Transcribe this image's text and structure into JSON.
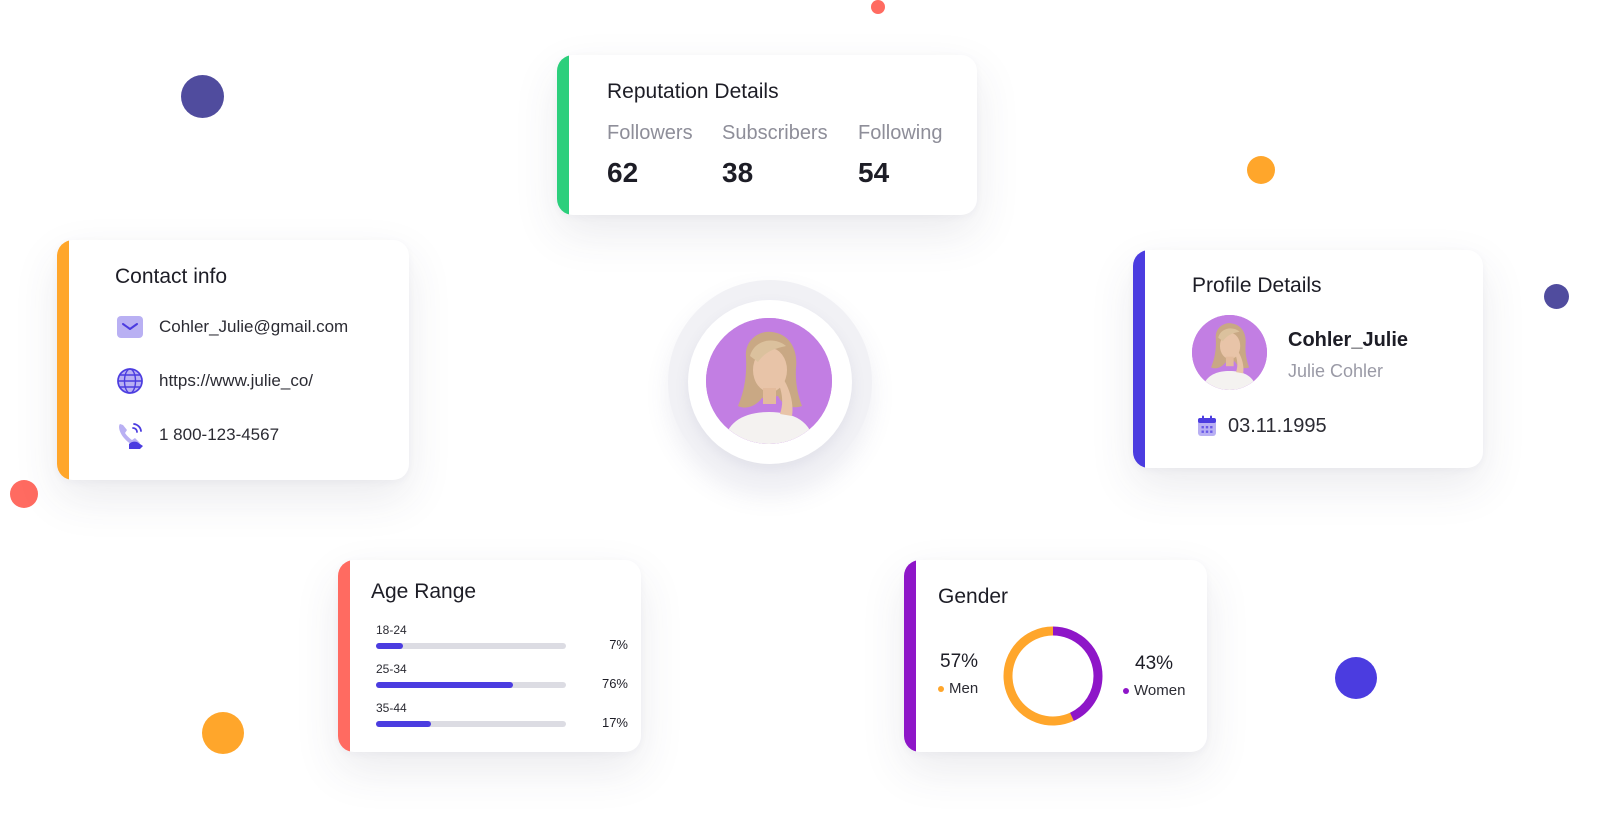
{
  "colors": {
    "green": "#2ccf7c",
    "orange": "#ffa62b",
    "indigo": "#4b3ce0",
    "coral": "#ff6b61",
    "purple": "#8e16c8",
    "navy": "#504c9e",
    "avatar_bg": "#c27ee3",
    "progress": "#4b3ce0"
  },
  "reputation": {
    "title": "Reputation Details",
    "stats": [
      {
        "label": "Followers",
        "value": "62"
      },
      {
        "label": "Subscribers",
        "value": "38"
      },
      {
        "label": "Following",
        "value": "54"
      }
    ]
  },
  "contact": {
    "title": "Contact info",
    "email": "Cohler_Julie@gmail.com",
    "website": "https://www.julie_co/",
    "phone": "1 800-123-4567"
  },
  "profile": {
    "title": "Profile Details",
    "username": "Cohler_Julie",
    "full_name": "Julie Cohler",
    "birth_date": "03.11.1995"
  },
  "age_range": {
    "title": "Age Range",
    "rows": [
      {
        "label": "18-24",
        "percent_text": "7%",
        "fraction": 0.14
      },
      {
        "label": "25-34",
        "percent_text": "76%",
        "fraction": 0.72
      },
      {
        "label": "35-44",
        "percent_text": "17%",
        "fraction": 0.29
      }
    ]
  },
  "gender": {
    "title": "Gender",
    "men": {
      "percent_text": "57%",
      "label": "Men",
      "value": 57
    },
    "women": {
      "percent_text": "43%",
      "label": "Women",
      "value": 43
    }
  }
}
